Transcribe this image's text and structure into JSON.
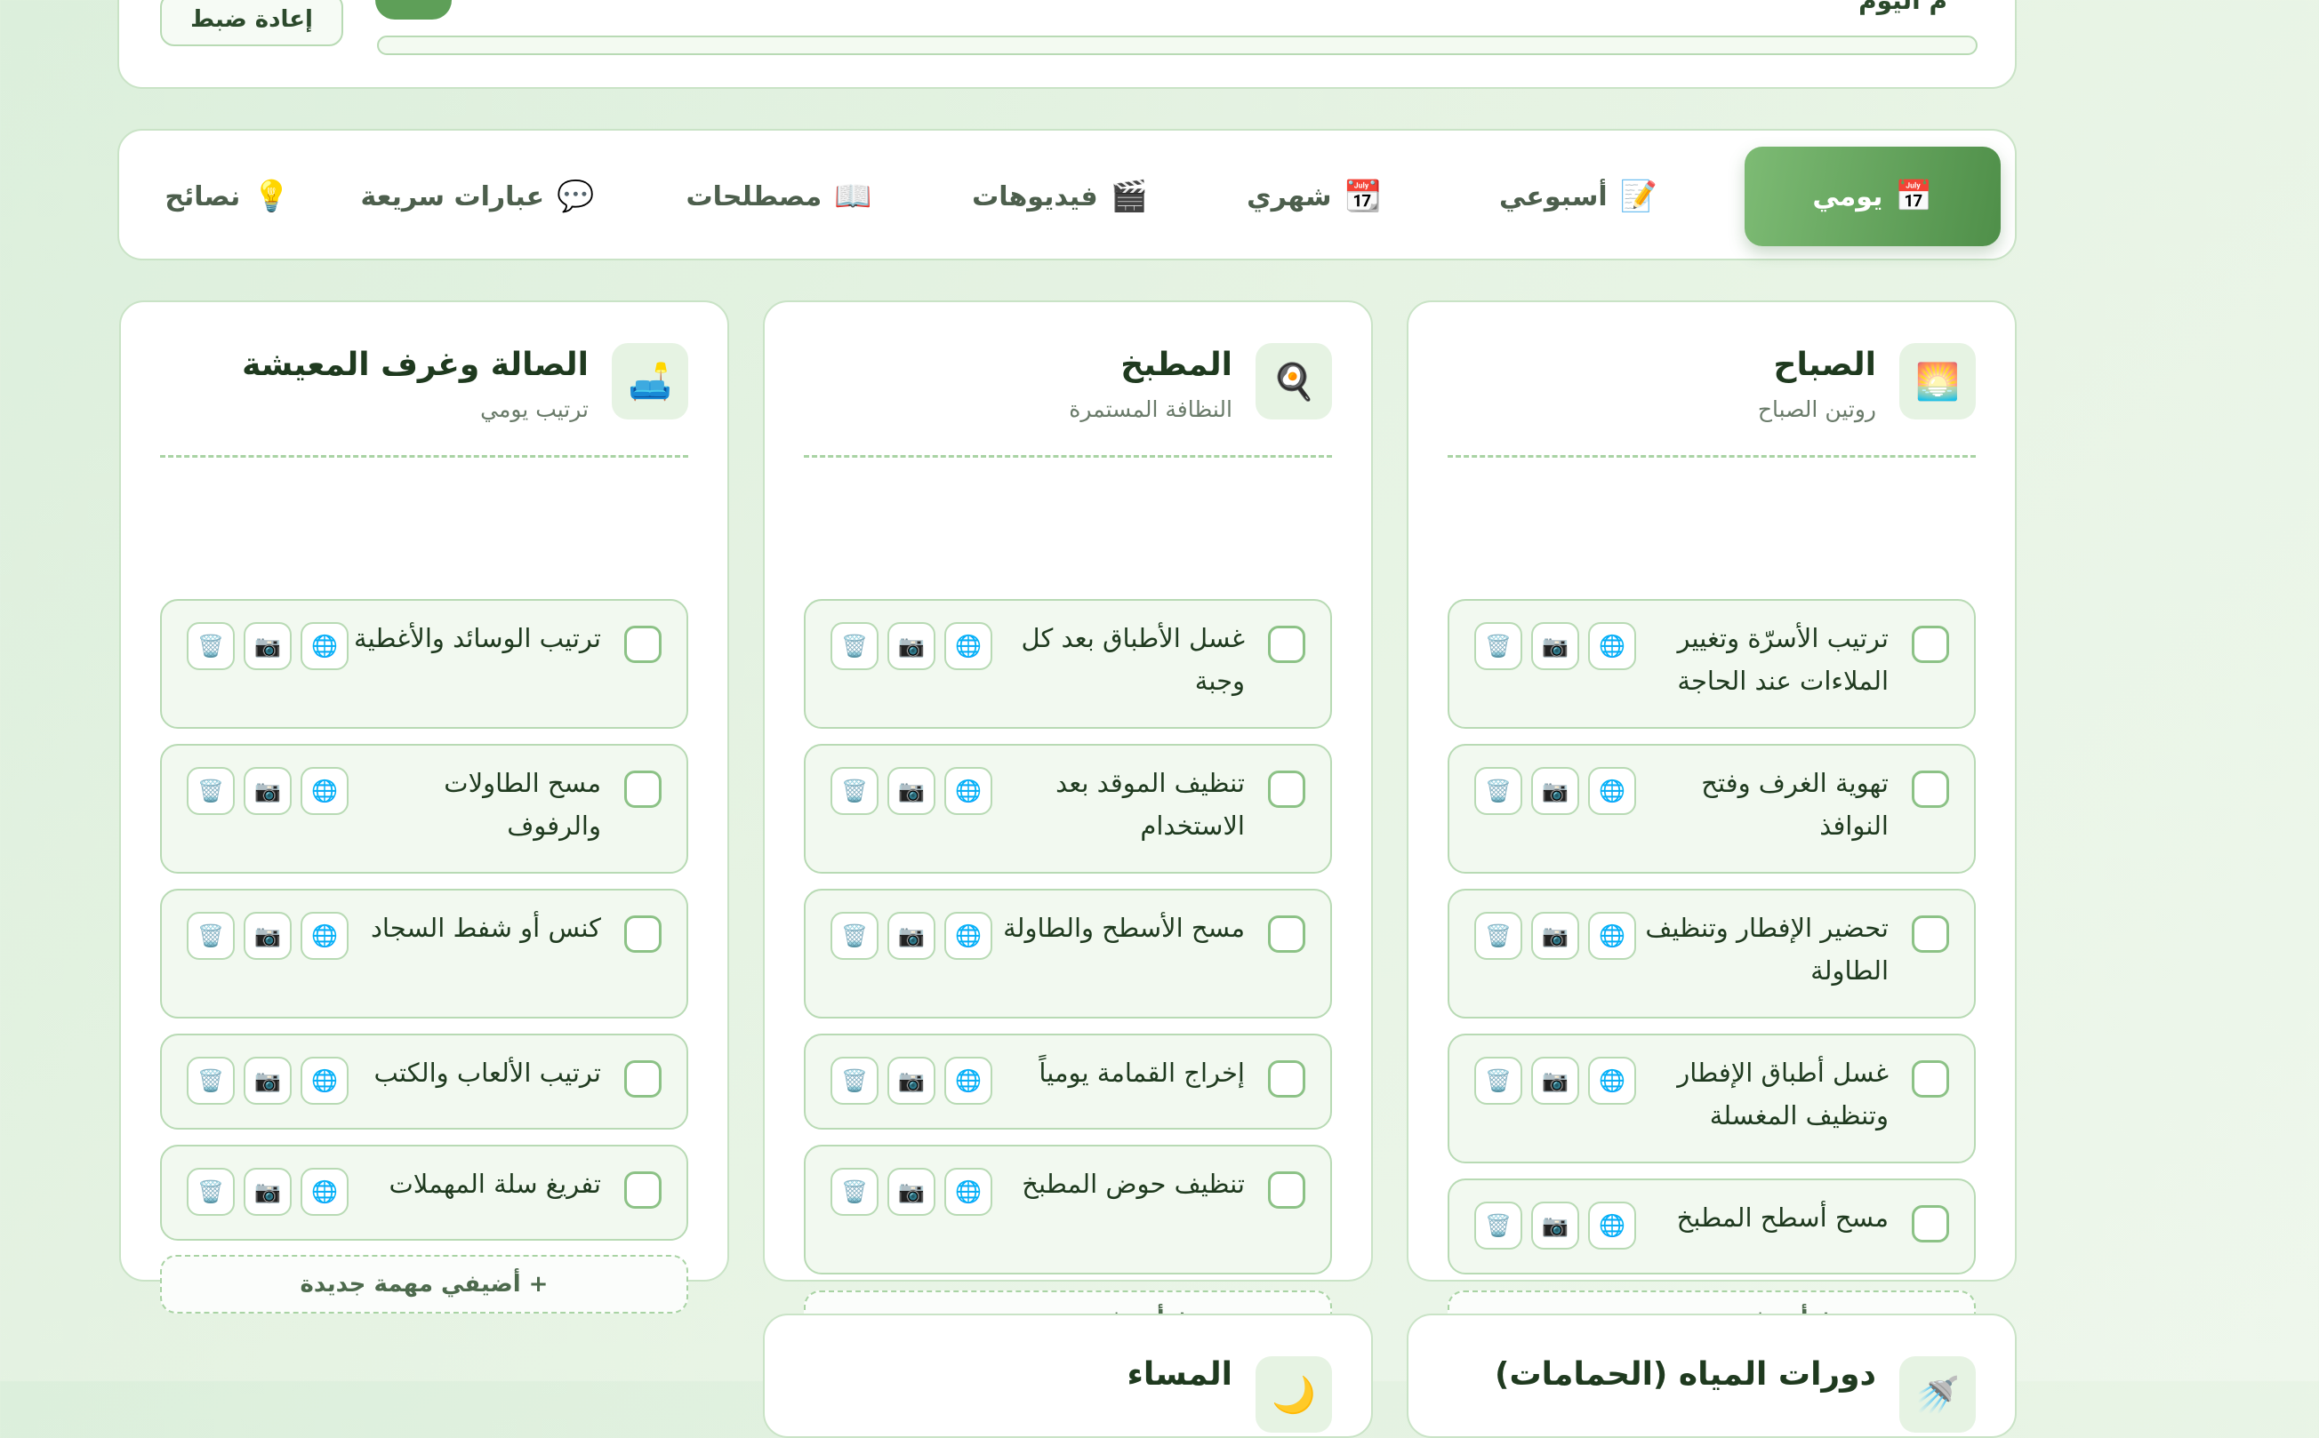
{
  "top": {
    "reset_label": "إعادة ضبط",
    "status_text": "م اليوم",
    "progress_fraction": 0
  },
  "tabs": [
    {
      "label": "يومي",
      "icon": "📅",
      "active": true
    },
    {
      "label": "أسبوعي",
      "icon": "📝",
      "active": false
    },
    {
      "label": "شهري",
      "icon": "📆",
      "active": false
    },
    {
      "label": "فيديوهات",
      "icon": "🎬",
      "active": false
    },
    {
      "label": "مصطلحات",
      "icon": "📖",
      "active": false
    },
    {
      "label": "عبارات سريعة",
      "icon": "💬",
      "active": false
    },
    {
      "label": "نصائح",
      "icon": "💡",
      "active": false
    }
  ],
  "cards": [
    {
      "title": "الصباح",
      "subtitle": "روتين الصباح",
      "icon": "🌅",
      "tasks": [
        "ترتيب الأسرّة وتغيير الملاءات عند الحاجة",
        "تهوية الغرف وفتح النوافذ",
        "تحضير الإفطار وتنظيف الطاولة",
        "غسل أطباق الإفطار وتنظيف المغسلة",
        "مسح أسطح المطبخ"
      ],
      "add_label": "+ أضيفي مهمة جديدة"
    },
    {
      "title": "المطبخ",
      "subtitle": "النظافة المستمرة",
      "icon": "🍳",
      "tasks": [
        "غسل الأطباق بعد كل وجبة",
        "تنظيف الموقد بعد الاستخدام",
        "مسح الأسطح والطاولة",
        "إخراج القمامة يومياً",
        "تنظيف حوض المطبخ"
      ],
      "add_label": "+ أضيفي مهمة جديدة"
    },
    {
      "title": "الصالة وغرف المعيشة",
      "subtitle": "ترتيب يومي",
      "icon": "🛋️",
      "tasks": [
        "ترتيب الوسائد والأغطية",
        "مسح الطاولات والرفوف",
        "كنس أو شفط السجاد",
        "ترتيب الألعاب والكتب",
        "تفريغ سلة المهملات"
      ],
      "add_label": "+ أضيفي مهمة جديدة"
    }
  ],
  "bottom_cards": [
    {
      "title": "دورات المياه (الحمامات)",
      "icon": "🚿"
    },
    {
      "title": "المساء",
      "icon": "🌙"
    }
  ],
  "action_icons": {
    "translate": "🌐",
    "photo": "📷",
    "delete": "🗑️"
  }
}
